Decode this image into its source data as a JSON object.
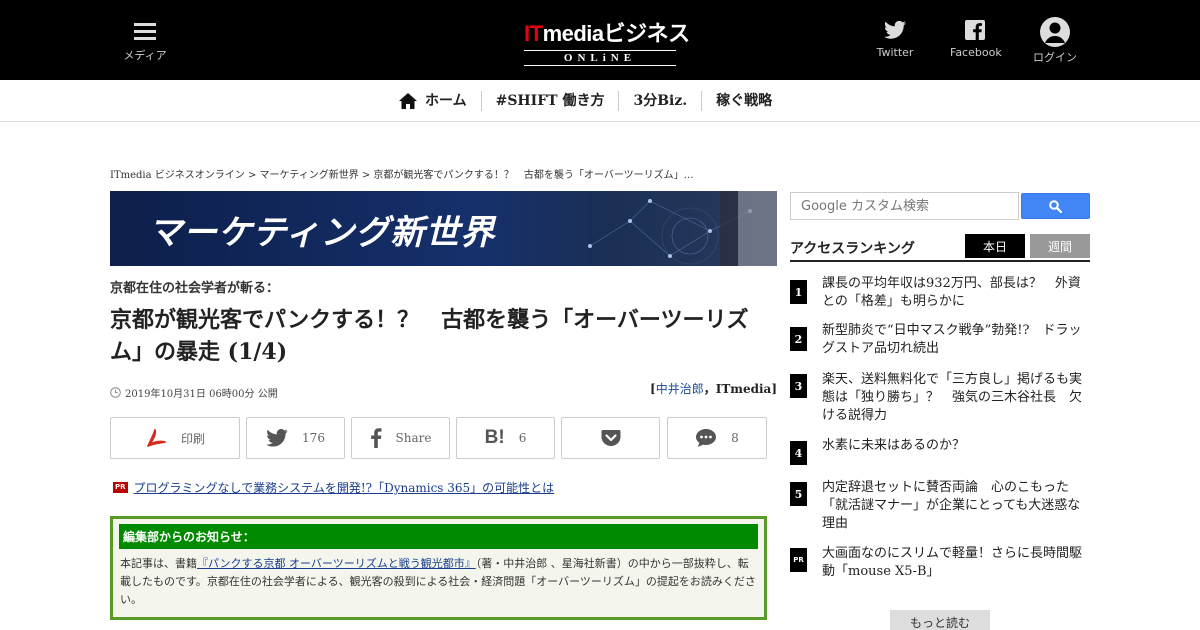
{
  "header": {
    "menu_label": "メディア",
    "logo_main_it": "IT",
    "logo_main_rest": "mediaビジネス",
    "logo_sub": "ONLiNE",
    "twitter_label": "Twitter",
    "facebook_label": "Facebook",
    "login_label": "ログイン"
  },
  "nav": {
    "items": [
      {
        "label": "ホーム"
      },
      {
        "label": "#SHIFT 働き方"
      },
      {
        "label": "3分Biz."
      },
      {
        "label": "稼ぐ戦略"
      }
    ]
  },
  "breadcrumb": "ITmedia ビジネスオンライン > マーケティング新世界 > 京都が観光客でパンクする！？　古都を襲う「オーバーツーリズム」…",
  "banner": {
    "title": "マーケティング新世界"
  },
  "article": {
    "subhead": "京都在住の社会学者が斬る：",
    "title": "京都が観光客でパンクする！？　古都を襲う「オーバーツーリズム」の暴走 (1/4)",
    "date": "2019年10月31日 06時00分 公開",
    "author_open": "[",
    "author_name": "中井治郎",
    "author_rest": "，ITmedia]"
  },
  "share": {
    "print": "印刷",
    "tweet_count": "176",
    "share": "Share",
    "hatena_count": "6",
    "comment_count": "8"
  },
  "pr": {
    "badge": "PR",
    "link": "プログラミングなしで業務システムを開発!?「Dynamics 365」の可能性とは"
  },
  "notice": {
    "heading": "編集部からのお知らせ：",
    "text_before": "本記事は、書籍",
    "book_link": "『パンクする京都 オーバーツーリズムと戦う観光都市』",
    "text_after": "（著・中井治郎 、星海社新書）の中から一部抜粋し、転載したものです。京都在住の社会学者による、観光客の殺到による社会・経済問題「オーバーツーリズム」の提起をお読みください。"
  },
  "search": {
    "placeholder": "Google カスタム検索"
  },
  "ranking": {
    "title": "アクセスランキング",
    "tab_today": "本日",
    "tab_week": "週間",
    "items": [
      {
        "num": "1",
        "text": "課長の平均年収は932万円、部長は？　外資との「格差」も明らかに"
      },
      {
        "num": "2",
        "text": "新型肺炎で“日中マスク戦争”勃発!?　ドラッグストア品切れ続出"
      },
      {
        "num": "3",
        "text": "楽天、送料無料化で「三方良し」掲げるも実態は「独り勝ち」？　強気の三木谷社長　欠ける説得力"
      },
      {
        "num": "4",
        "text": "水素に未来はあるのか？"
      },
      {
        "num": "5",
        "text": "内定辞退セットに賛否両論　心のこもった「就活謎マナー」が企業にとっても大迷惑な理由"
      },
      {
        "num": "PR",
        "text": "大画面なのにスリムで軽量！さらに長時間駆動「mouse X5-B」"
      }
    ],
    "more": "もっと読む"
  },
  "colors": {
    "header_bg": "#000000",
    "logo_accent": "#e60012",
    "search_button": "#4285f4",
    "notice_border": "#5a9a2a",
    "notice_heading": "#008a00",
    "link": "#1a3e8c"
  }
}
